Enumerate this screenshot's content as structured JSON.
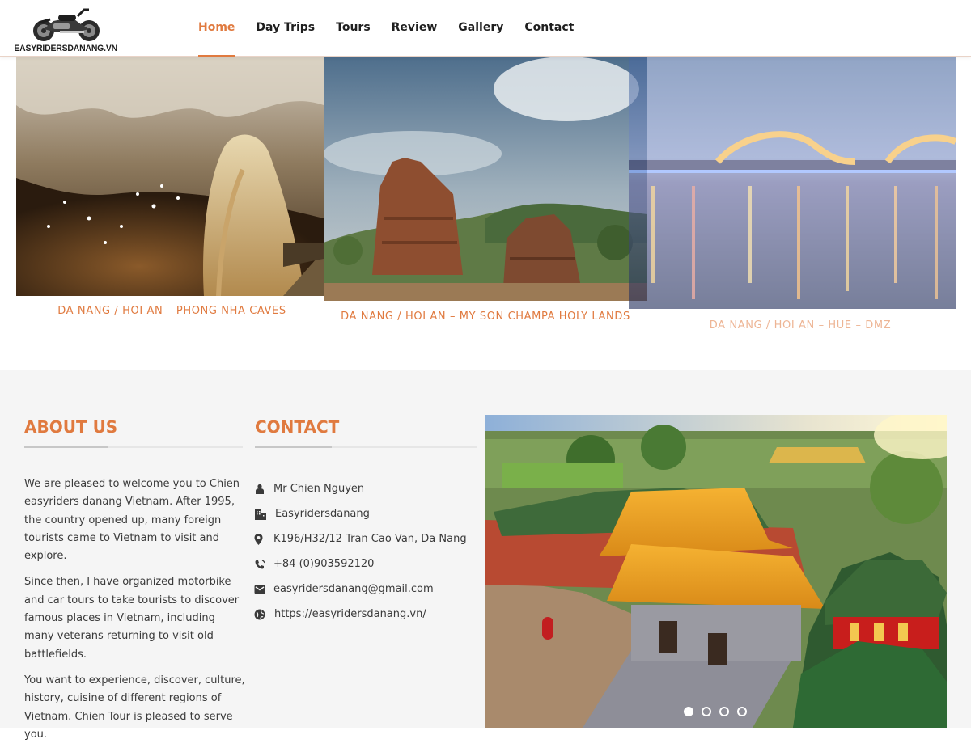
{
  "header": {
    "logo_text": "EASYRIDERSDANANG.VN",
    "nav": [
      {
        "label": "Home",
        "active": true
      },
      {
        "label": "Day Trips",
        "active": false
      },
      {
        "label": "Tours",
        "active": false
      },
      {
        "label": "Review",
        "active": false
      },
      {
        "label": "Gallery",
        "active": false
      },
      {
        "label": "Contact",
        "active": false
      }
    ]
  },
  "tours": [
    {
      "title": "DA NANG / HOI AN – PHONG NHA CAVES",
      "image": "cave-photo"
    },
    {
      "title": "DA NANG / HOI AN – MY SON CHAMPA HOLY LANDS",
      "image": "temple-ruins-photo"
    },
    {
      "title": "DA NANG / HOI AN – HUE – DMZ",
      "image": "dragon-bridge-photo"
    }
  ],
  "about": {
    "heading": "ABOUT US",
    "paragraphs": [
      "We are pleased to welcome you to Chien easyriders danang Vietnam. After 1995, the country opened up, many foreign tourists came to Vietnam to visit and explore.",
      "Since then, I have organized motorbike and car tours to take tourists to discover famous places in Vietnam, including many veterans returning to visit old battlefields.",
      "You want to experience, discover, culture, history, cuisine of different regions of Vietnam. Chien Tour is pleased to serve you."
    ]
  },
  "contact": {
    "heading": "CONTACT",
    "items": [
      {
        "icon": "person-icon",
        "text": "Mr Chien Nguyen"
      },
      {
        "icon": "building-icon",
        "text": "Easyridersdanang"
      },
      {
        "icon": "map-marker-icon",
        "text": "K196/H32/12 Tran Cao Van, Da Nang"
      },
      {
        "icon": "phone-icon",
        "text": "+84 (0)903592120"
      },
      {
        "icon": "envelope-icon",
        "text": "easyridersdanang@gmail.com"
      },
      {
        "icon": "globe-icon",
        "text": "https://easyridersdanang.vn/"
      }
    ]
  },
  "slider": {
    "image": "imperial-citadel-photo",
    "slide_count": 4,
    "active_slide": 1
  },
  "colors": {
    "accent": "#e07a3f",
    "text": "#3a3a3a",
    "section_bg": "#f5f5f5"
  }
}
